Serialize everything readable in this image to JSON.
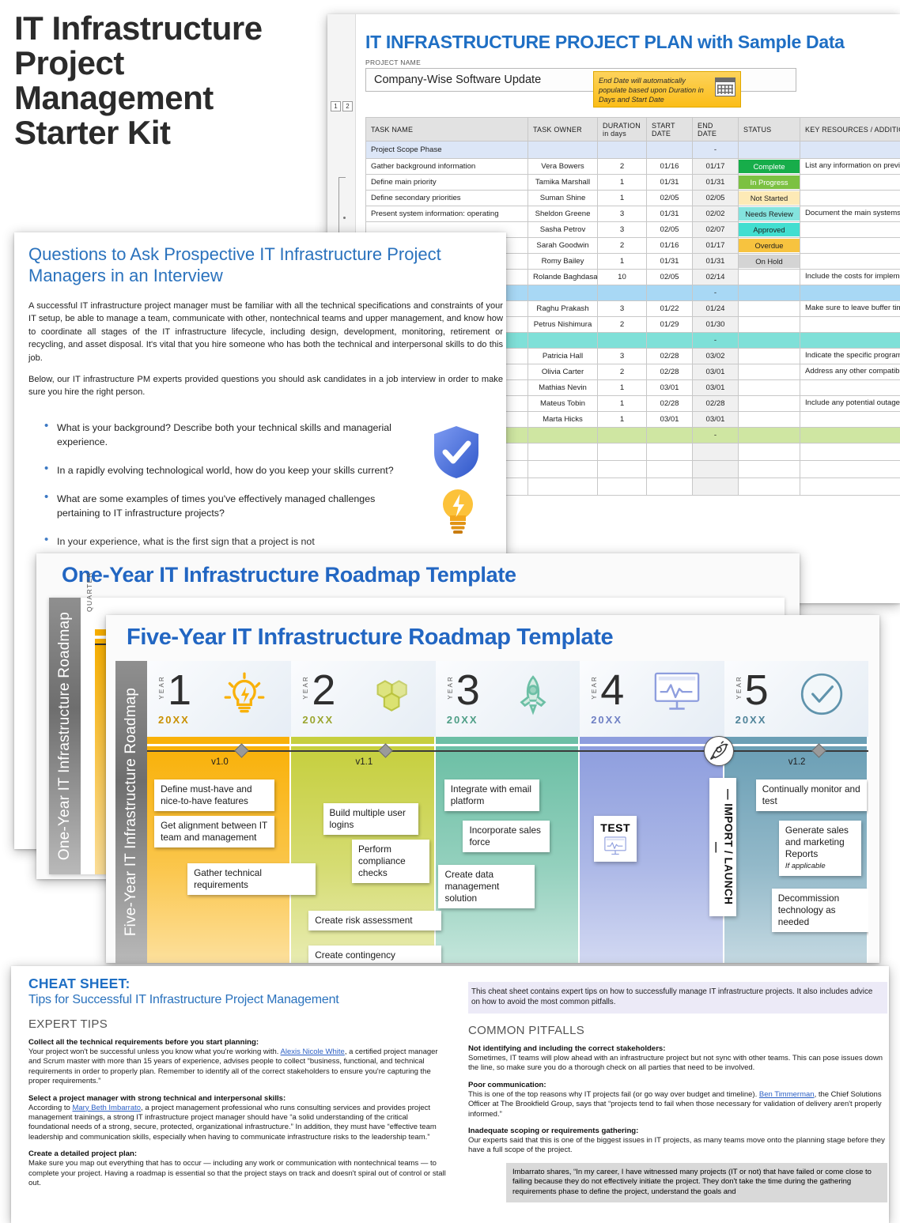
{
  "hero": {
    "title": "IT Infrastructure Project Management Starter Kit"
  },
  "spreadsheet": {
    "title": "IT INFRASTRUCTURE PROJECT PLAN with Sample Data",
    "project_name_label": "PROJECT NAME",
    "project_name_value": "Company-Wise Software Update",
    "callout": "End Date will automatically populate based upon Duration in Days and Start Date",
    "callout_icon": "calendar-icon",
    "outline_buttons": [
      "1",
      "2"
    ],
    "columns": [
      "TASK NAME",
      "TASK OWNER",
      "DURATION in days",
      "START DATE",
      "END DATE",
      "STATUS",
      "KEY RESOURCES / ADDITIONAL NOTES"
    ],
    "column_duration_line1": "DURATION",
    "column_duration_line2": "in days",
    "column_start_line1": "START",
    "column_start_line2": "DATE",
    "column_end_line1": "END",
    "column_end_line2": "DATE",
    "rows": [
      {
        "type": "phase",
        "task": "Project Scope Phase",
        "owner": "",
        "duration": "",
        "start": "",
        "end": "-",
        "status": "",
        "notes": ""
      },
      {
        "type": "task",
        "task": "Gather background information",
        "owner": "Vera Bowers",
        "duration": "2",
        "start": "01/16",
        "end": "01/17",
        "status": "Complete",
        "status_class": "bg-complete",
        "notes": "List any information on previous or outdated infrastructure that the"
      },
      {
        "type": "task",
        "task": "Define main priority",
        "owner": "Tamika Marshall",
        "duration": "1",
        "start": "01/31",
        "end": "01/31",
        "status": "In Progress",
        "status_class": "bg-inprogress",
        "notes": ""
      },
      {
        "type": "task",
        "task": "Define secondary priorities",
        "owner": "Suman Shine",
        "duration": "1",
        "start": "02/05",
        "end": "02/05",
        "status": "Not Started",
        "status_class": "bg-notstarted",
        "notes": ""
      },
      {
        "type": "task",
        "task": "Present system information: operating",
        "owner": "Sheldon Greene",
        "duration": "3",
        "start": "01/31",
        "end": "02/02",
        "status": "Needs Review",
        "status_class": "bg-needsreview",
        "notes": "Document the main systems, programs that your project will touch, and notes about their compatibility, lifespan"
      },
      {
        "type": "task",
        "task": "",
        "owner": "Sasha Petrov",
        "duration": "3",
        "start": "02/05",
        "end": "02/07",
        "status": "Approved",
        "status_class": "bg-approved",
        "notes": ""
      },
      {
        "type": "task",
        "task": "",
        "owner": "Sarah Goodwin",
        "duration": "2",
        "start": "01/16",
        "end": "01/17",
        "status": "Overdue",
        "status_class": "bg-overdue",
        "notes": ""
      },
      {
        "type": "task",
        "task": "",
        "owner": "Romy Bailey",
        "duration": "1",
        "start": "01/31",
        "end": "01/31",
        "status": "On Hold",
        "status_class": "bg-onhold",
        "notes": ""
      },
      {
        "type": "task",
        "task": "",
        "owner": "Rolande Baghdasaryan",
        "duration": "10",
        "start": "02/05",
        "end": "02/14",
        "status": "",
        "status_class": "",
        "notes": "Include the costs for implementation and maintenance."
      },
      {
        "type": "sec-blue",
        "task": "",
        "owner": "",
        "duration": "",
        "start": "",
        "end": "-",
        "status": "",
        "notes": ""
      },
      {
        "type": "task",
        "task": "",
        "owner": "Raghu Prakash",
        "duration": "3",
        "start": "01/22",
        "end": "01/24",
        "status": "",
        "status_class": "",
        "notes": "Make sure to leave buffer time for foreseeable delays or ongoing"
      },
      {
        "type": "task",
        "task": "",
        "owner": "Petrus Nishimura",
        "duration": "2",
        "start": "01/29",
        "end": "01/30",
        "status": "",
        "status_class": "",
        "notes": ""
      },
      {
        "type": "sec-teal",
        "task": "",
        "owner": "",
        "duration": "",
        "start": "",
        "end": "-",
        "status": "",
        "notes": ""
      },
      {
        "type": "task",
        "task": "",
        "owner": "Patricia Hall",
        "duration": "3",
        "start": "02/28",
        "end": "03/02",
        "status": "",
        "status_class": "",
        "notes": "Indicate the specific programs"
      },
      {
        "type": "task",
        "task": "",
        "owner": "Olivia Carter",
        "duration": "2",
        "start": "02/28",
        "end": "03/01",
        "status": "",
        "status_class": "",
        "notes": "Address any other compatibility issues in front of before updating the"
      },
      {
        "type": "task",
        "task": "",
        "owner": "Mathias Nevin",
        "duration": "1",
        "start": "03/01",
        "end": "03/01",
        "status": "",
        "status_class": "",
        "notes": ""
      },
      {
        "type": "task",
        "task": "",
        "owner": "Mateus Tobin",
        "duration": "1",
        "start": "02/28",
        "end": "02/28",
        "status": "",
        "status_class": "",
        "notes": "Include any potential outages that might occur during the installation"
      },
      {
        "type": "task",
        "task": "",
        "owner": "Marta Hicks",
        "duration": "1",
        "start": "03/01",
        "end": "03/01",
        "status": "",
        "status_class": "",
        "notes": ""
      },
      {
        "type": "sec-green",
        "task": "",
        "owner": "",
        "duration": "",
        "start": "",
        "end": "-",
        "status": "",
        "notes": ""
      },
      {
        "type": "blank",
        "task": "",
        "owner": "",
        "duration": "",
        "start": "",
        "end": "",
        "status": "",
        "notes": ""
      },
      {
        "type": "blank",
        "task": "",
        "owner": "",
        "duration": "",
        "start": "",
        "end": "",
        "status": "",
        "notes": ""
      },
      {
        "type": "blank",
        "task": "",
        "owner": "",
        "duration": "",
        "start": "",
        "end": "",
        "status": "",
        "notes": ""
      }
    ]
  },
  "interview": {
    "title": "Questions to Ask Prospective IT Infrastructure Project Managers in an Interview",
    "paragraph1": "A successful IT infrastructure project manager must be familiar with all the technical specifications and constraints of your IT setup, be able to manage a team, communicate with other, nontechnical teams and upper management, and know how to coordinate all stages of the IT infrastructure lifecycle, including design, development, monitoring, retirement or recycling, and asset disposal. It's vital that you hire someone who has both the technical and interpersonal skills to do this job.",
    "paragraph2": "Below, our IT infrastructure PM experts provided questions you should ask candidates in a job interview in order to make sure you hire the right person.",
    "questions": [
      "What is your background? Describe both your technical skills and managerial experience.",
      "In a rapidly evolving technological world, how do you keep your skills current?",
      "What are some examples of times you've effectively managed challenges pertaining to IT infrastructure projects?",
      "In your experience, what is the first sign that a project is not"
    ],
    "icons": [
      "shield-check-icon",
      "lightbulb-icon"
    ]
  },
  "one_year_roadmap": {
    "title": "One-Year IT Infrastructure Roadmap Template",
    "side_tab": "One-Year IT Infrastructure Roadmap",
    "axis_label": "QUARTER"
  },
  "five_year_roadmap": {
    "title": "Five-Year IT Infrastructure Roadmap Template",
    "side_tab": "Five-Year IT Infrastructure Roadmap",
    "year_word": "YEAR",
    "year_placeholder": "20XX",
    "years": [
      {
        "num": "1",
        "icon": "lightbulb-icon",
        "color": "#f9b109",
        "band": "#f9b109",
        "xx_color": "#c99000"
      },
      {
        "num": "2",
        "icon": "cubes-icon",
        "color": "#c6cf3e",
        "band": "#c6cf3e",
        "xx_color": "#9ba52f"
      },
      {
        "num": "3",
        "icon": "rocket-icon",
        "color": "#6cbfa5",
        "band": "#6cbfa5",
        "xx_color": "#4e9e86"
      },
      {
        "num": "4",
        "icon": "monitor-pulse-icon",
        "color": "#8e9ede",
        "band": "#8e9ede",
        "xx_color": "#6f80c4"
      },
      {
        "num": "5",
        "icon": "check-circle-icon",
        "color": "#6b9fb5",
        "band": "#6b9fb5",
        "xx_color": "#4f8399"
      }
    ],
    "milestones": [
      {
        "label": "v1.0",
        "year": 1
      },
      {
        "label": "v1.1",
        "year": 2
      },
      {
        "label": "v1.2",
        "year": 5
      }
    ],
    "launch_marker": {
      "label": "IMPORT / LAUNCH",
      "icon": "rocket-pin-icon"
    },
    "test_marker": {
      "label": "TEST",
      "icon": "monitor-pulse-icon"
    },
    "tasks": [
      {
        "text": "Define must-have and nice-to-have features",
        "year": 1
      },
      {
        "text": "Get alignment between IT team and management",
        "year": 1
      },
      {
        "text": "Gather technical requirements",
        "year": 1
      },
      {
        "text": "Build multiple user logins",
        "year": 2
      },
      {
        "text": "Perform compliance checks",
        "year": 2
      },
      {
        "text": "Create risk assessment",
        "year": 2
      },
      {
        "text": "Create contingency",
        "year": 2
      },
      {
        "text": "Integrate with email platform",
        "year": 3
      },
      {
        "text": "Incorporate sales force",
        "year": 3
      },
      {
        "text": "Create data management solution",
        "year": 3
      },
      {
        "text": "Continually monitor and test",
        "year": 5
      },
      {
        "text": "Generate sales and marketing Reports",
        "note": "If applicable",
        "year": 5
      },
      {
        "text": "Decommission technology as needed",
        "year": 5
      }
    ]
  },
  "cheat_sheet": {
    "heading": "CHEAT SHEET:",
    "subheading": "Tips for Successful IT Infrastructure Project Management",
    "intro": "This cheat sheet contains expert tips on how to successfully manage IT infrastructure projects. It also includes advice on how to avoid the most common pitfalls.",
    "left_section_title": "EXPERT TIPS",
    "right_section_title": "COMMON PITFALLS",
    "expert_tips": [
      {
        "head": "Collect all the technical requirements before you start planning:",
        "body_pre": "Your project won't be successful unless you know what you're working with. ",
        "link": "Alexis Nicole White",
        "body_post": ", a certified project manager and Scrum master with more than 15 years of experience, advises people to collect “business, functional, and technical requirements in order to properly plan. Remember to identify all of the correct stakeholders to ensure you're capturing the proper requirements.”"
      },
      {
        "head": "Select a project manager with strong technical and interpersonal skills:",
        "body_pre": "According to ",
        "link": "Mary Beth Imbarrato",
        "body_post": ", a project management professional who runs consulting services and provides project management trainings, a strong IT infrastructure project manager should have “a solid understanding of the critical foundational needs of a strong, secure, protected, organizational infrastructure.” In addition, they must have “effective team leadership and communication skills, especially when having to communicate infrastructure risks to the leadership team.”"
      },
      {
        "head": "Create a detailed project plan:",
        "body_pre": "Make sure you map out everything that has to occur — including any work or communication with nontechnical teams — to complete your project. Having a roadmap is essential so that the project stays on track and doesn't spiral out of control or stall out.",
        "link": "",
        "body_post": ""
      }
    ],
    "common_pitfalls": [
      {
        "head": "Not identifying and including the correct stakeholders:",
        "body_pre": "Sometimes, IT teams will plow ahead with an infrastructure project but not sync with other teams. This can pose issues down the line, so make sure you do a thorough check on all parties that need to be involved.",
        "link": "",
        "body_post": ""
      },
      {
        "head": "Poor communication:",
        "body_pre": "This is one of the top reasons why IT projects fail (or go way over budget and timeline). ",
        "link": "Ben Timmerman",
        "body_post": ", the Chief Solutions Officer at The Brookfield Group, says that “projects tend to fail when those necessary for validation of delivery aren't properly informed.”"
      },
      {
        "head": "Inadequate scoping or requirements gathering:",
        "body_pre": "Our experts said that this is one of the biggest issues in IT projects, as many teams move onto the planning stage before they have a full scope of the project.",
        "link": "",
        "body_post": ""
      }
    ],
    "quote": "Imbarrato shares, “In my career, I have witnessed many projects (IT or not) that have failed or come close to failing because they do not effectively initiate the project. They don't take the time during the gathering requirements phase to define the project, understand the goals and"
  }
}
